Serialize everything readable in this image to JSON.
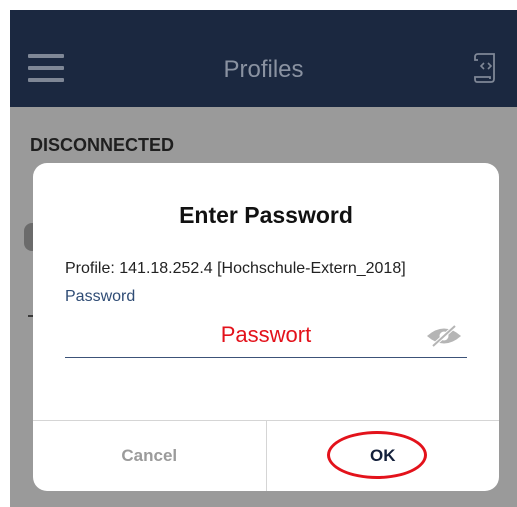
{
  "header": {
    "title": "Profiles",
    "menu_icon": "hamburger-icon",
    "right_icon": "scroll-code-icon"
  },
  "background": {
    "section_label": "DISCONNECTED"
  },
  "dialog": {
    "title": "Enter Password",
    "profile_line": "Profile: 141.18.252.4 [Hochschule-Extern_2018]",
    "password_label": "Password",
    "password_value": "Passwort",
    "visibility_icon": "eye-slash-icon",
    "cancel_label": "Cancel",
    "ok_label": "OK"
  },
  "colors": {
    "header_bg": "#1b2840",
    "backdrop": "#9a9a9a",
    "annotation_red": "#e3121b",
    "label_blue": "#2f4c75"
  }
}
